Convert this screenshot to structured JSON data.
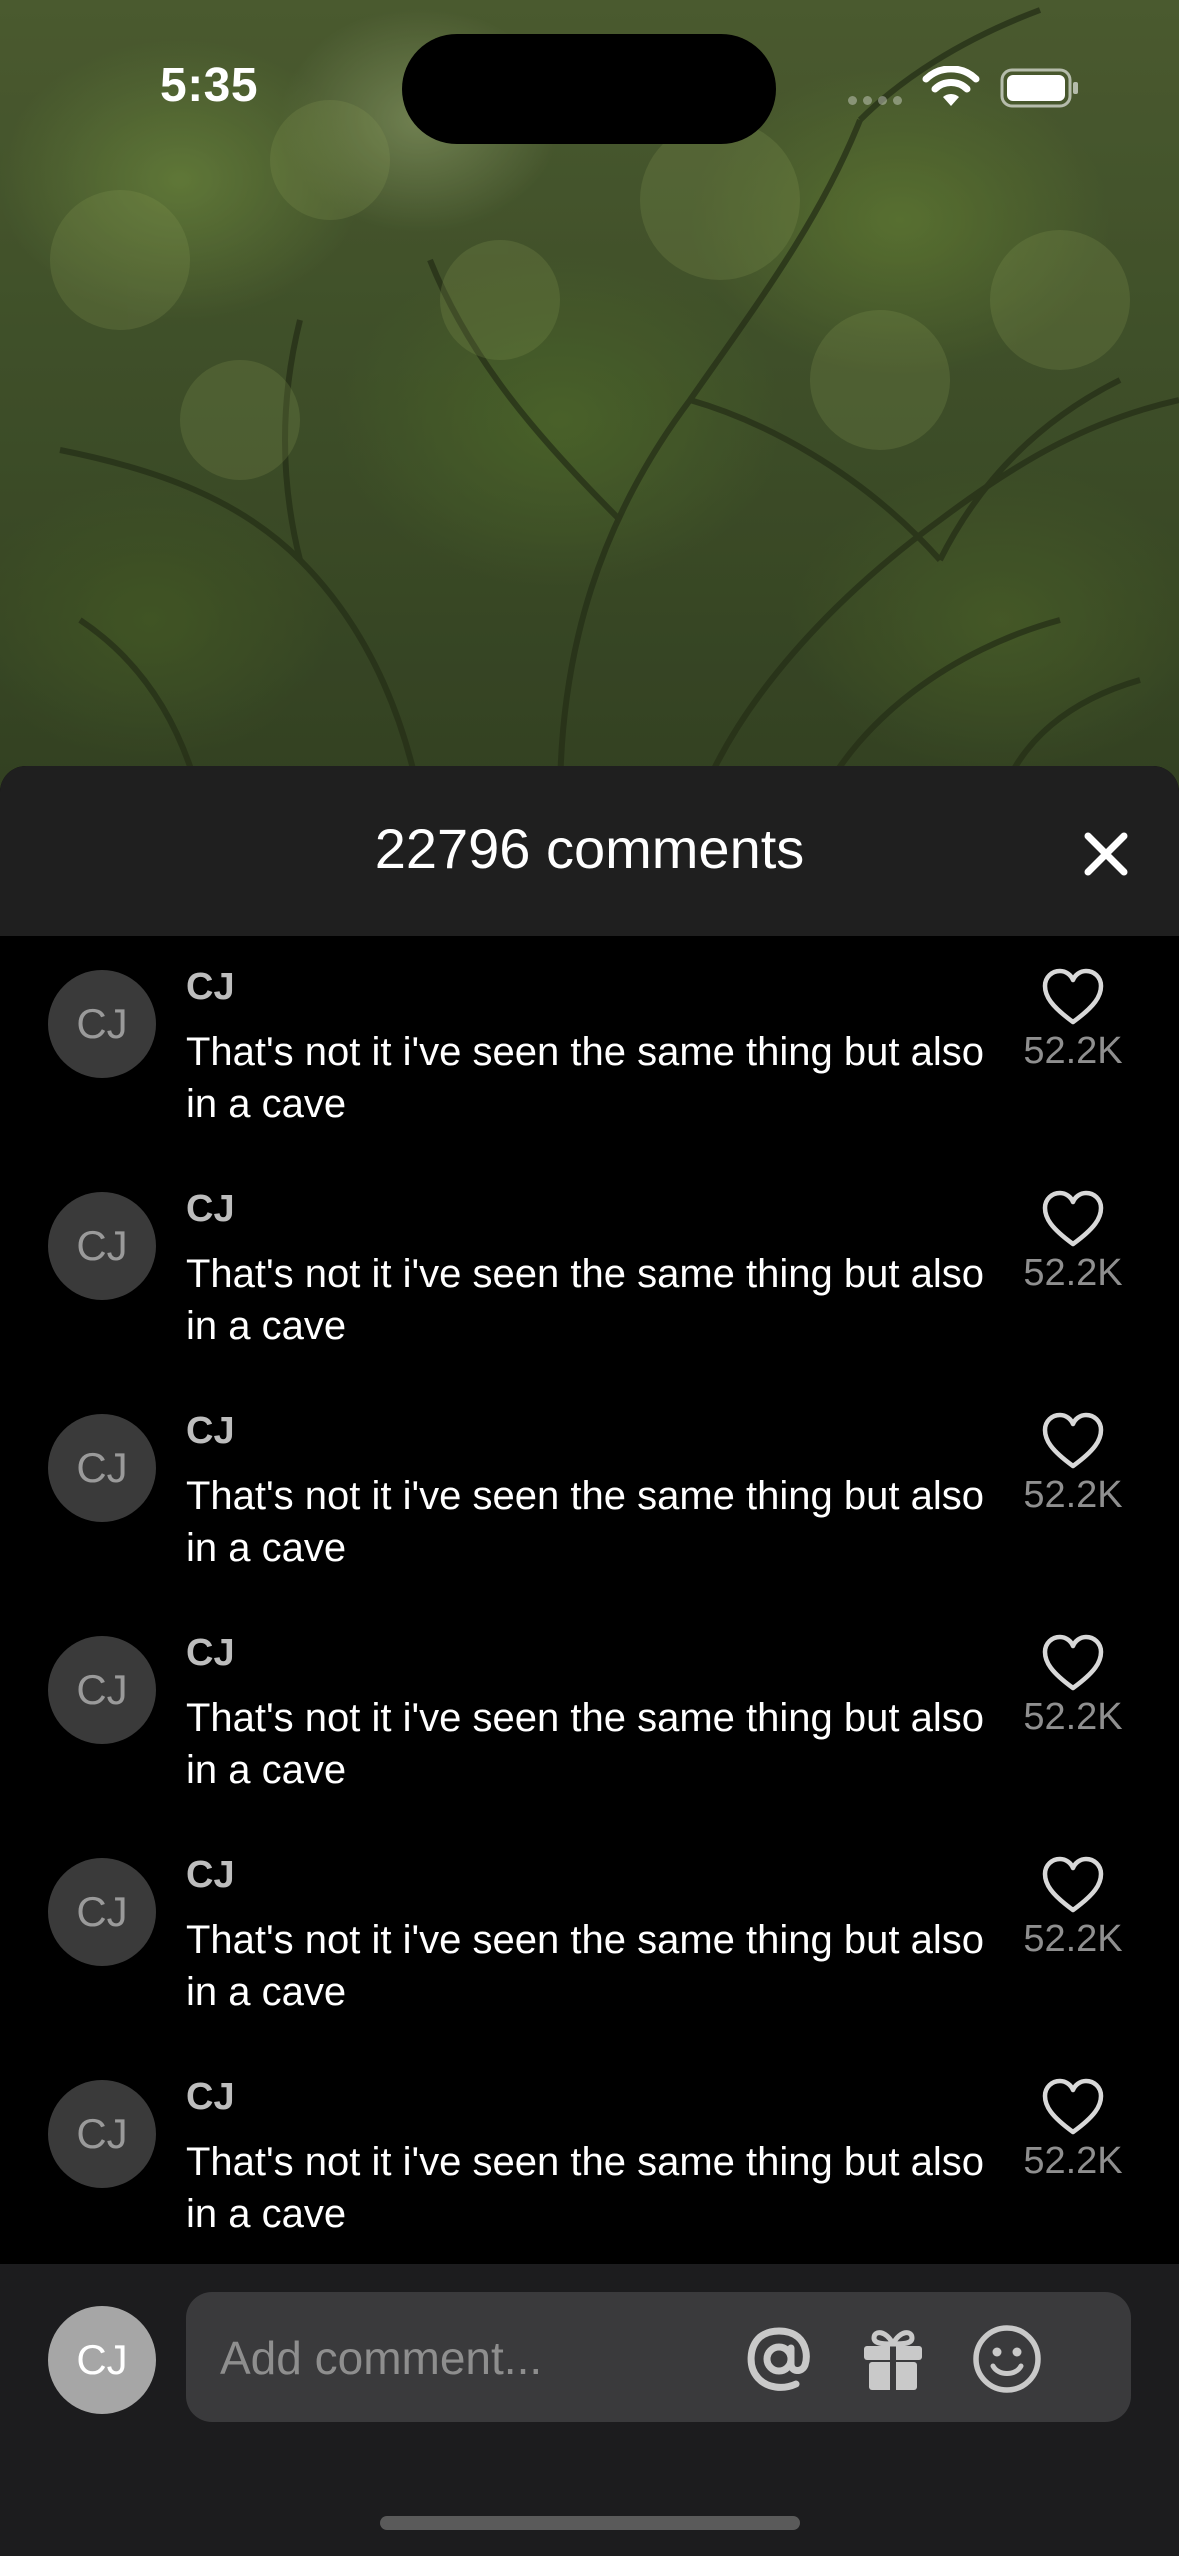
{
  "status_bar": {
    "time": "5:35"
  },
  "sheet": {
    "title": "22796 comments"
  },
  "comments": [
    {
      "avatar": "CJ",
      "username": "CJ",
      "text": "That's not it i've seen the same thing but also in a cave",
      "likes": "52.2K"
    },
    {
      "avatar": "CJ",
      "username": "CJ",
      "text": "That's not it i've seen the same thing but also in a cave",
      "likes": "52.2K"
    },
    {
      "avatar": "CJ",
      "username": "CJ",
      "text": "That's not it i've seen the same thing but also in a cave",
      "likes": "52.2K"
    },
    {
      "avatar": "CJ",
      "username": "CJ",
      "text": "That's not it i've seen the same thing but also in a cave",
      "likes": "52.2K"
    },
    {
      "avatar": "CJ",
      "username": "CJ",
      "text": "That's not it i've seen the same thing but also in a cave",
      "likes": "52.2K"
    },
    {
      "avatar": "CJ",
      "username": "CJ",
      "text": "That's not it i've seen the same thing but also in a cave",
      "likes": "52.2K"
    }
  ],
  "composer": {
    "avatar": "CJ",
    "placeholder": "Add comment...",
    "tools": [
      "at-sign-icon",
      "gift-icon",
      "emoji-icon"
    ]
  },
  "colors": {
    "sheet_header_bg": "#1f1f1f",
    "list_bg": "#000000",
    "composer_bg": "#1c1c1e",
    "input_bg": "#3a3a3c"
  }
}
